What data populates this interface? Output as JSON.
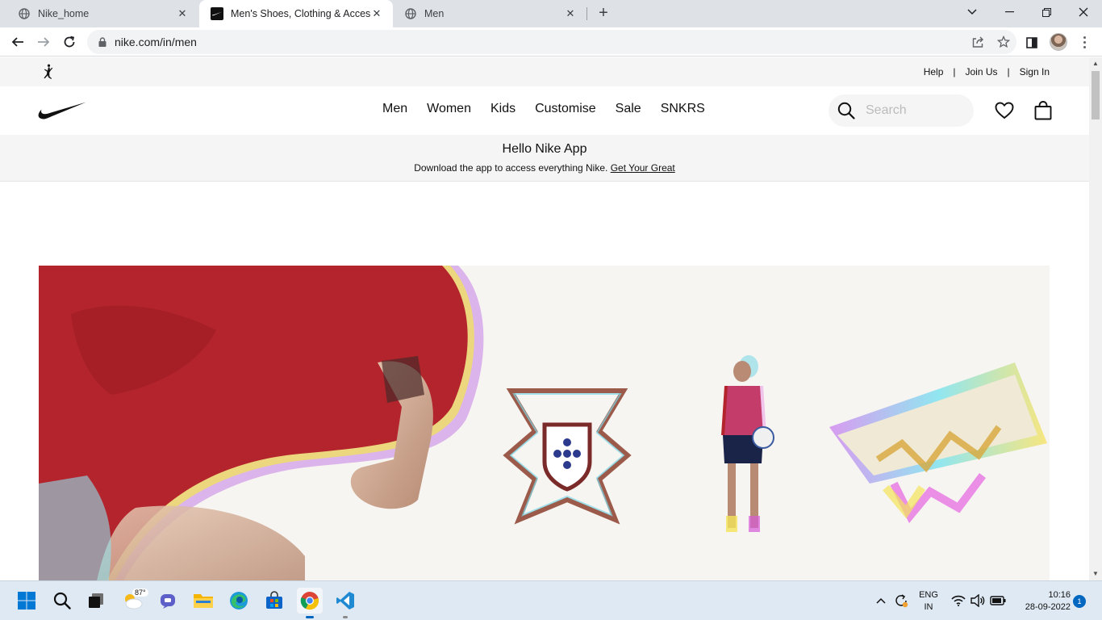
{
  "browser": {
    "tabs": [
      {
        "title": "Nike_home",
        "active": false
      },
      {
        "title": "Men's Shoes, Clothing & Accessories",
        "active": true
      },
      {
        "title": "Men",
        "active": false
      }
    ],
    "url": "nike.com/in/men"
  },
  "nike": {
    "util_links": [
      "Help",
      "Join Us",
      "Sign In"
    ],
    "util_separator": "|",
    "nav": [
      "Men",
      "Women",
      "Kids",
      "Customise",
      "Sale",
      "SNKRS"
    ],
    "search_placeholder": "Search",
    "promo": {
      "title": "Hello Nike App",
      "subtitle": "Download the app to access everything Nike.",
      "link": "Get Your Great"
    }
  },
  "taskbar": {
    "weather_temp": "87°",
    "lang_line1": "ENG",
    "lang_line2": "IN",
    "time": "10:16",
    "date": "28-09-2022",
    "notifications": "1"
  },
  "colors": {
    "accent": "#0067c0",
    "nike_black": "#111111",
    "tabstrip": "#dee1e6",
    "hero_red": "#b3242c"
  }
}
